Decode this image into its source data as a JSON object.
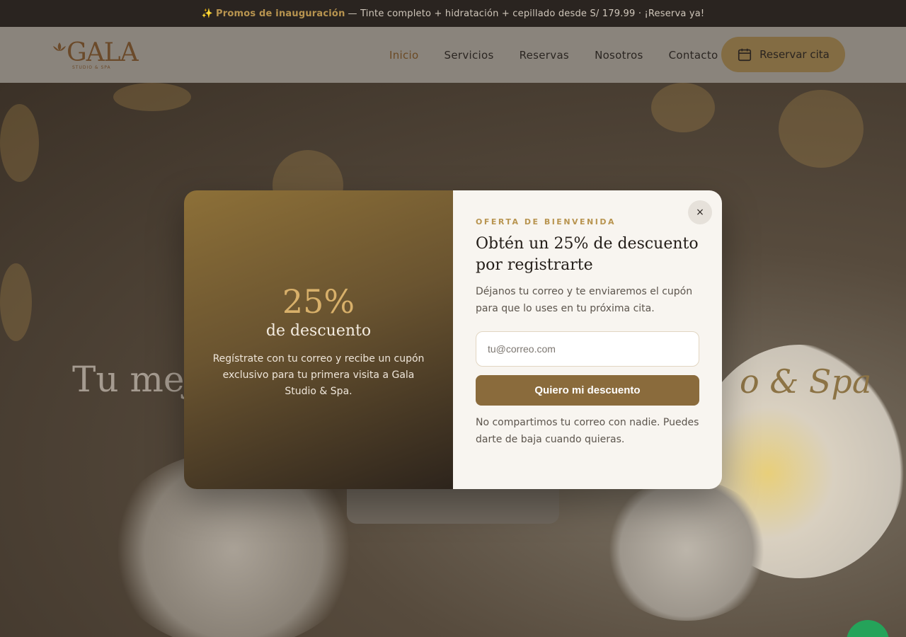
{
  "promo": {
    "icon": "sparkles-icon",
    "highlight": "Promos de inauguración",
    "text": "— Tinte completo + hidratación + cepillado desde S/ 179.99 · ¡Reserva ya!"
  },
  "header": {
    "logo_text": "GALA",
    "logo_sub": "STUDIO & SPA",
    "nav": [
      {
        "label": "Inicio",
        "active": true
      },
      {
        "label": "Servicios",
        "active": false
      },
      {
        "label": "Reservas",
        "active": false
      },
      {
        "label": "Nosotros",
        "active": false
      },
      {
        "label": "Contacto",
        "active": false
      }
    ],
    "cta_label": "Reservar cita",
    "cta_icon": "calendar-icon"
  },
  "hero": {
    "title_left": "Tu mej",
    "title_right": "o & Spa"
  },
  "modal": {
    "left": {
      "percent": "25%",
      "subtitle": "de descuento",
      "description": "Regístrate con tu correo y recibe un cupón exclusivo para tu primera visita a Gala Studio & Spa."
    },
    "right": {
      "eyebrow": "OFERTA DE BIENVENIDA",
      "title": "Obtén un 25% de descuento por registrarte",
      "description": "Déjanos tu correo y te enviaremos el cupón para que lo uses en tu próxima cita.",
      "email_placeholder": "tu@correo.com",
      "email_value": "",
      "submit_label": "Quiero mi descuento",
      "privacy": "No compartimos tu correo con nadie. Puedes darte de baja cuando quieras.",
      "close_label": "×"
    }
  },
  "colors": {
    "accent": "#b8944f",
    "button": "#8a6b3c",
    "whatsapp": "#25a35a"
  }
}
